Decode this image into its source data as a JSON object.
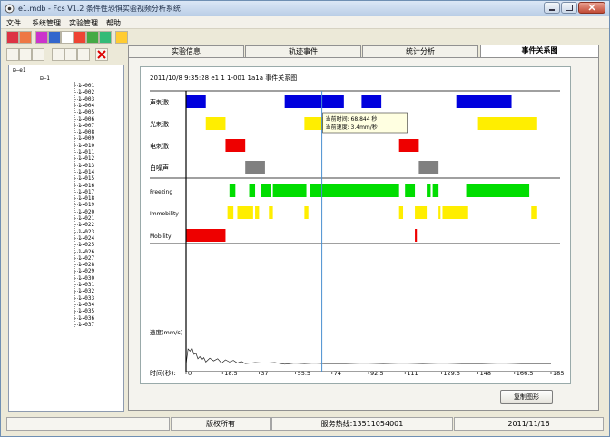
{
  "window": {
    "title": "e1.mdb - Fcs V1.2 条件性恐惧实验视频分析系统"
  },
  "menu": [
    "文件",
    "系统管理",
    "实验管理",
    "帮助"
  ],
  "tabs": [
    "实验信息",
    "轨迹事件",
    "统计分析",
    "事件关系图"
  ],
  "active_tab_index": 3,
  "tree": {
    "root": "e1",
    "group": "1",
    "items": [
      "1-001",
      "1-002",
      "1-003",
      "1-004",
      "1-005",
      "1-006",
      "1-007",
      "1-008",
      "1-009",
      "1-010",
      "1-011",
      "1-012",
      "1-013",
      "1-014",
      "1-015",
      "1-016",
      "1-017",
      "1-018",
      "1-019",
      "1-020",
      "1-021",
      "1-022",
      "1-023",
      "1-024",
      "1-025",
      "1-026",
      "1-027",
      "1-028",
      "1-029",
      "1-030",
      "1-031",
      "1-032",
      "1-033",
      "1-034",
      "1-035",
      "1-036",
      "1-037"
    ]
  },
  "chart_header": "2011/10/8 9:35:28  e1  1  1-001  1a1a  事件关系图",
  "tooltip": {
    "line1": "当前时间: 68.844 秒",
    "line2": "当前速度: 3.4mm/秒"
  },
  "buttons": {
    "copy": "复制图形"
  },
  "status": {
    "copyright": "版权所有",
    "hotline": "服务热线:13511054001",
    "date": "2011/11/16"
  },
  "chart_data": {
    "type": "event-timeline",
    "title": "事件关系图",
    "cursor_time": 68.844,
    "cursor_speed": 3.4,
    "x": {
      "label": "时间(秒):",
      "min": 0,
      "max": 185,
      "ticks": [
        0,
        18.5,
        37,
        55.5,
        74,
        92.5,
        111,
        129.5,
        148,
        166.5,
        185
      ],
      "tick_labels": [
        "0",
        "18.5",
        "37",
        "55.5",
        "74",
        "92.5",
        "111",
        "129.5",
        "148",
        "166.5",
        "185"
      ]
    },
    "events": [
      {
        "name": "声刺激",
        "color": "#0000dd",
        "intervals": [
          [
            0,
            10
          ],
          [
            50,
            80
          ],
          [
            89,
            99
          ],
          [
            137,
            165
          ]
        ]
      },
      {
        "name": "光刺激",
        "color": "#ffee00",
        "intervals": [
          [
            10,
            20
          ],
          [
            60,
            70
          ],
          [
            148,
            178
          ]
        ]
      },
      {
        "name": "电刺激",
        "color": "#ee0000",
        "intervals": [
          [
            20,
            30
          ],
          [
            108,
            118
          ]
        ]
      },
      {
        "name": "白噪声",
        "color": "#808080",
        "intervals": [
          [
            30,
            40
          ],
          [
            118,
            128
          ]
        ]
      }
    ],
    "behaviors": [
      {
        "name": "Freezing",
        "color": "#00dd00",
        "intervals": [
          [
            22,
            25
          ],
          [
            32,
            35
          ],
          [
            38,
            43
          ],
          [
            44,
            61
          ],
          [
            63,
            108
          ],
          [
            111,
            116
          ],
          [
            122,
            124
          ],
          [
            125,
            128
          ],
          [
            142,
            174
          ]
        ]
      },
      {
        "name": "Immobility",
        "color": "#ffee00",
        "intervals": [
          [
            21,
            24
          ],
          [
            26,
            34
          ],
          [
            35,
            37
          ],
          [
            42,
            44
          ],
          [
            60,
            62
          ],
          [
            108,
            110
          ],
          [
            116,
            122
          ],
          [
            128,
            129
          ],
          [
            130,
            143
          ],
          [
            175,
            178
          ]
        ]
      },
      {
        "name": "Mobility",
        "color": "#ee0000",
        "intervals": [
          [
            0,
            20
          ],
          [
            116,
            117
          ]
        ]
      }
    ],
    "speed": {
      "label": "速度(mm/s)",
      "t": [
        0,
        1,
        2,
        3,
        4,
        5,
        6,
        7,
        8,
        9,
        10,
        12,
        14,
        16,
        18,
        20,
        22,
        24,
        26,
        28,
        30,
        35,
        40,
        45,
        50,
        55,
        60,
        65,
        70,
        80,
        90,
        100,
        110,
        120,
        130,
        140,
        150,
        160,
        170,
        180,
        185
      ],
      "v": [
        2,
        30,
        26,
        32,
        20,
        22,
        12,
        16,
        10,
        14,
        6,
        13,
        8,
        12,
        4,
        10,
        6,
        9,
        4,
        7,
        3,
        5,
        4,
        5,
        2,
        4,
        3,
        4,
        3,
        3,
        4,
        3,
        4,
        3,
        4,
        3,
        3,
        4,
        3,
        3,
        3
      ],
      "max": 80
    }
  }
}
